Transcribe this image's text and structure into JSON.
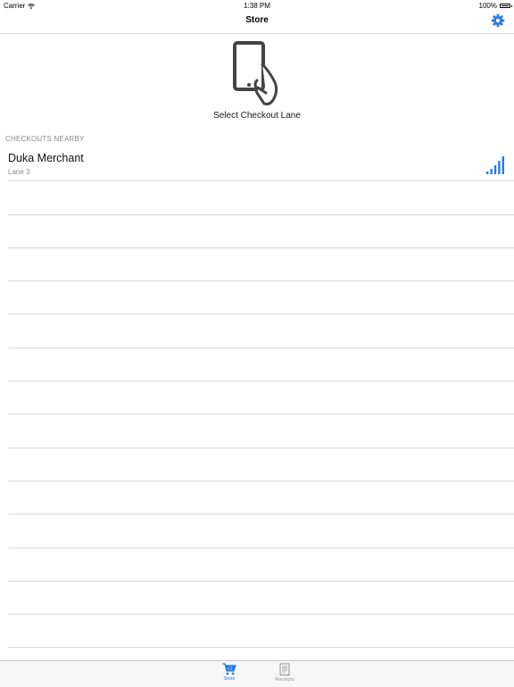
{
  "status_bar": {
    "carrier": "Carrier",
    "time": "1:38 PM",
    "battery": "100%",
    "icons": [
      "wifi-icon",
      "battery-icon"
    ]
  },
  "nav": {
    "title": "Store",
    "settings_icon": "gear-icon"
  },
  "hero": {
    "icon": "phone-in-hand-icon",
    "label": "Select Checkout Lane"
  },
  "section": {
    "header": "CHECKOUTS NEARBY"
  },
  "checkouts": [
    {
      "title": "Duka Merchant",
      "subtitle": "Lane 3",
      "icon": "signal-strength-icon"
    }
  ],
  "tab_bar": {
    "tabs": [
      {
        "label": "Store",
        "icon": "cart-icon",
        "selected": true
      },
      {
        "label": "Receipts",
        "icon": "receipt-icon",
        "selected": false
      }
    ]
  },
  "colors": {
    "accent": "#2a7ae2",
    "separator": "#d8d8d8",
    "secondary_text": "#8a8a8f",
    "tab_inactive": "#929292"
  }
}
